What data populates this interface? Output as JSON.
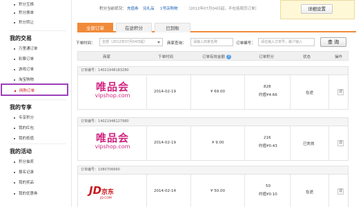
{
  "sidebar": {
    "top_items": [
      "积分互换",
      "积分换单",
      "积分转让"
    ],
    "sections": [
      {
        "title": "我的交易",
        "items": [
          "万里通订单",
          "彩票订单",
          "游戏订单",
          "淘宝购物",
          "网购订单"
        ]
      },
      {
        "title": "我的专享",
        "items": [
          "专享积分",
          "我的红包",
          "我的抵值"
        ]
      },
      {
        "title": "我的活动",
        "items": [
          "积分抽奖",
          "报名记录",
          "我的奖品",
          "我的优惠券"
        ]
      }
    ],
    "active_item": "网购订单"
  },
  "topbar": {
    "label": "积分当前状况：",
    "links": [
      "充值券",
      "兑礼品",
      "1号店购物"
    ],
    "note": "（2012年07月04日起，不包括周页订单）",
    "detail_button": "详细设置"
  },
  "tabs": [
    "全部订单",
    "在途积分",
    "已到账"
  ],
  "filter": {
    "time_label": "下单时间：",
    "time_value": "全部（2012年07月04日起）",
    "merchant_label": "商家查询：",
    "merchant_placeholder": "请输入商家名称",
    "order_label": "订单编号：",
    "order_placeholder": "请在输入订单号，最少输入",
    "search_button": "查 询"
  },
  "table": {
    "headers": [
      "商家",
      "下单时间",
      "订单有效金额",
      "订单积分",
      "状态",
      "操作"
    ],
    "help_icon": "?",
    "order_prefix": "订单编号：",
    "rows": [
      {
        "order_no": "14021948183280",
        "merchant": "唯品会",
        "merchant_en": "vipshop.com",
        "date": "2014-02-19",
        "amount": "¥ 69.00",
        "points": "828",
        "points_value": "约值¥4.66",
        "status": "在途",
        "op": "详"
      },
      {
        "order_no": "14021948127980",
        "merchant": "唯品会",
        "merchant_en": "vipshop.com",
        "date": "2014-02-19",
        "amount": "¥ 9.00",
        "points": "216",
        "points_value": "约值¥0.43",
        "status": "已失效",
        "op": "详"
      },
      {
        "order_no": "1080706660",
        "merchant": "JD",
        "merchant_cn": "京东",
        "merchant_sub": "JD.COM",
        "date": "2014-02-14",
        "amount": "¥ 50.00",
        "points": "50",
        "points_value": "约值¥0.10",
        "status": "在途",
        "op": "详"
      }
    ]
  },
  "colors": {
    "accent": "#f08a3a",
    "highlight_box": "#9b3fb8",
    "vip": "#d0257f",
    "jd": "#c8161d",
    "link": "#1a5fb4"
  }
}
